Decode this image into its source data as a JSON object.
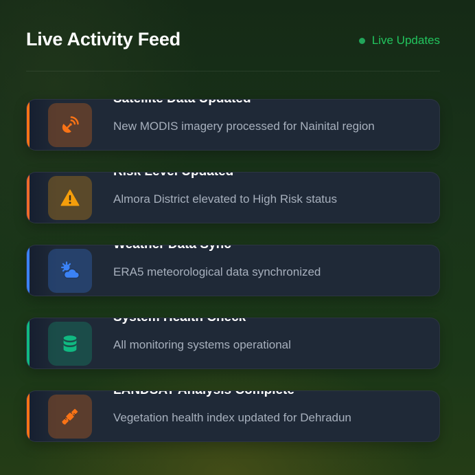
{
  "header": {
    "title": "Live Activity Feed",
    "live_label": "Live Updates"
  },
  "colors": {
    "live_green": "#22c55e",
    "card_bg": "#1f2937",
    "orange": "#f97316",
    "amber": "#f59e0b",
    "blue": "#3b82f6",
    "green": "#10b981"
  },
  "feed": {
    "items": [
      {
        "title": "Satellite Data Updated",
        "description": "New MODIS imagery processed for Nainital region",
        "icon": "satellite-dish-icon",
        "accent": "#f97316"
      },
      {
        "title": "Risk Level Updated",
        "description": "Almora District elevated to High Risk status",
        "icon": "warning-triangle-icon",
        "accent": "#ef6a2a"
      },
      {
        "title": "Weather Data Sync",
        "description": "ERA5 meteorological data synchronized",
        "icon": "cloud-sun-icon",
        "accent": "#3b82f6"
      },
      {
        "title": "System Health Check",
        "description": "All monitoring systems operational",
        "icon": "database-icon",
        "accent": "#10b981"
      },
      {
        "title": "LANDSAT Analysis Complete",
        "description": "Vegetation health index updated for Dehradun",
        "icon": "satellite-icon",
        "accent": "#f97316"
      }
    ]
  }
}
